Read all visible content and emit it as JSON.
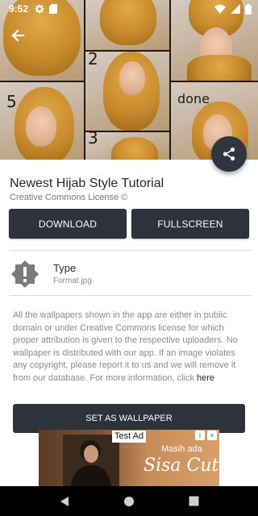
{
  "status_bar": {
    "time": "9:52",
    "icons_left": [
      "gear-icon",
      "sd-card-icon"
    ],
    "icons_right": [
      "wifi-icon",
      "signal-icon",
      "battery-icon"
    ]
  },
  "hero": {
    "step_labels": [
      "2",
      "5",
      "3"
    ],
    "done_label": "done"
  },
  "detail": {
    "title": "Newest Hijab Style Tutorial",
    "license": "Creative Commons License ©"
  },
  "actions": {
    "download_label": "DOWNLOAD",
    "fullscreen_label": "FULLSCREEN",
    "set_wallpaper_label": "SET AS WALLPAPER"
  },
  "info": {
    "type_label": "Type",
    "format_value": "Format jpg"
  },
  "disclaimer": {
    "text": "All the wallpapers shown in the app are either in public domain or under Creative Commons license for which proper attribution is given to the respective uploaders. No wallpaper is distributed with our app. If an image violates any copyright, please report it to us and we will remove it from our database. For more information, click ",
    "link": "here"
  },
  "ad": {
    "tag": "Test Ad",
    "line1": "Masih ada",
    "line2": "Sisa Cuti?"
  },
  "nav": {
    "icons": [
      "back-icon",
      "home-icon",
      "recents-icon"
    ]
  },
  "colors": {
    "button_dark": "#2d323b",
    "hijab": "#c88a2c",
    "text_primary": "#2a2a2a",
    "text_secondary": "#8a8a8a"
  }
}
